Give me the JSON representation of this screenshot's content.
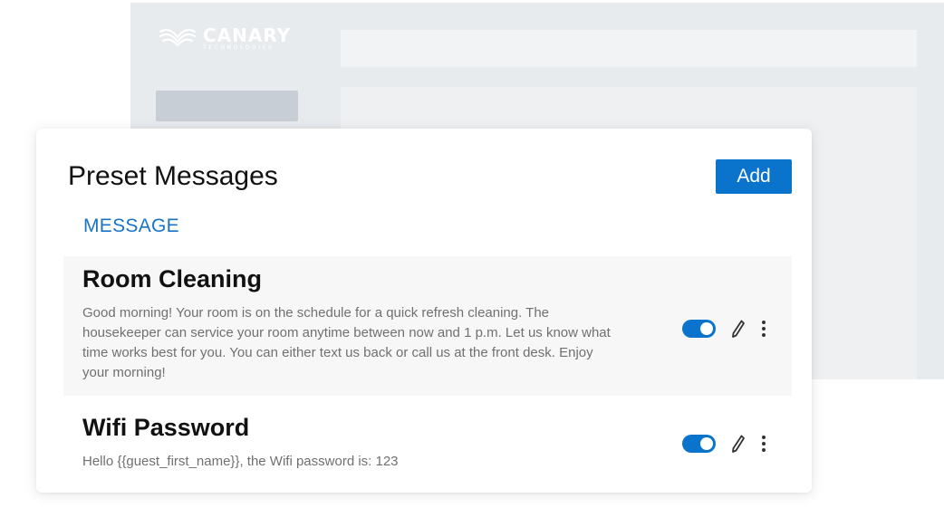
{
  "background": {
    "logo": {
      "name": "CANARY",
      "subtitle": "TECHNOLOGIES",
      "icon": "canary-wing-logo-icon"
    }
  },
  "card": {
    "title": "Preset Messages",
    "add_label": "Add",
    "column_header": "MESSAGE",
    "messages": [
      {
        "title": "Room Cleaning",
        "body": "Good morning! Your room is on the schedule for a quick refresh cleaning. The housekeeper can service your room anytime between now and 1 p.m. Let us know what time works best for you. You can either text us back or call us at the front desk. Enjoy your morning!",
        "enabled": true,
        "icons": [
          "toggle-switch-icon",
          "edit-pencil-icon",
          "more-vertical-icon"
        ]
      },
      {
        "title": "Wifi Password",
        "body": "Hello {{guest_first_name}}, the Wifi password is: 123",
        "enabled": true,
        "icons": [
          "toggle-switch-icon",
          "edit-pencil-icon",
          "more-vertical-icon"
        ]
      }
    ]
  },
  "colors": {
    "accent": "#0a74cc",
    "header_blue": "#1a73c7",
    "body_text": "#707070",
    "title_text": "#111111",
    "row_highlight": "#f7f7f7",
    "bg_app": "#e8ebee"
  }
}
